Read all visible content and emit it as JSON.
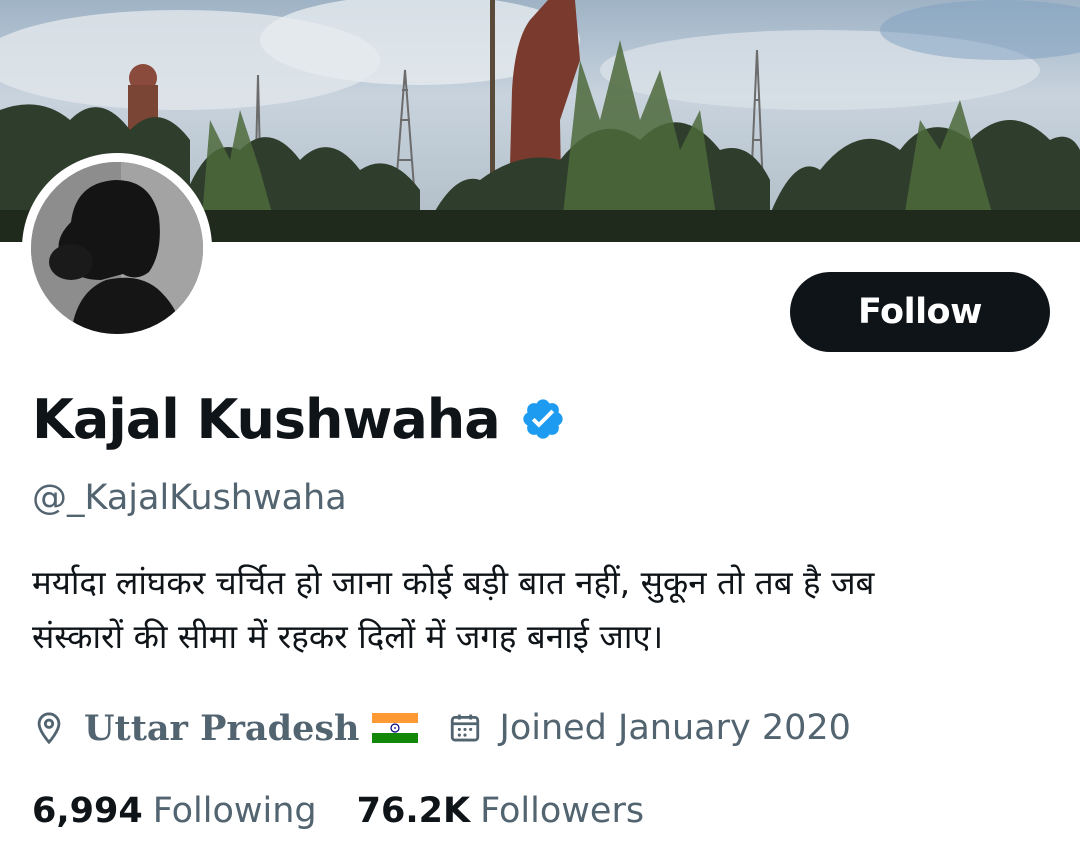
{
  "profile": {
    "name": "Kajal Kushwaha",
    "handle": "@_KajalKushwaha",
    "verified": true,
    "bio_lines": [
      "मर्यादा लांघकर चर्चित हो जाना कोई बड़ी बात नहीं, सुकून तो तब है जब",
      "संस्कारों की सीमा में रहकर दिलों में जगह बनाई जाए।"
    ],
    "location": "Uttar Pradesh",
    "location_flag": "india-flag",
    "joined": "Joined January 2020",
    "following_count": "6,994",
    "following_label": "Following",
    "followers_count": "76.2K",
    "followers_label": "Followers"
  },
  "actions": {
    "follow_label": "Follow"
  },
  "icons": {
    "location": "location-pin-icon",
    "calendar": "calendar-icon",
    "verified": "verified-badge-icon"
  },
  "colors": {
    "primary_text": "#0f1419",
    "secondary_text": "#536471",
    "verified_blue": "#1d9bf0",
    "follow_button_bg": "#0f1419",
    "follow_button_text": "#ffffff",
    "background": "#ffffff"
  }
}
